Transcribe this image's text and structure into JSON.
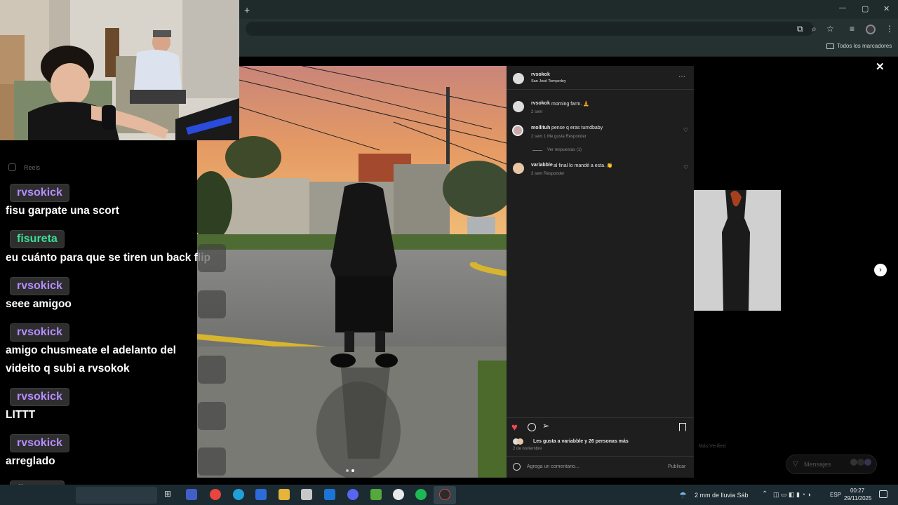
{
  "browser": {
    "new_tab": "+",
    "minimize": "—",
    "maximize": "▢",
    "close": "✕",
    "bookmarks_label": "Todos los marcadores"
  },
  "post": {
    "author": "rvsokok",
    "location": "San José Temperley",
    "caption_user": "rvsokok",
    "caption_text": "morning farm. 🧘",
    "caption_time": "2 sem",
    "comments": [
      {
        "user": "mollituh",
        "text": "pense q eras tumdbaby",
        "meta": "2 sem   1 Me gusta   Responder",
        "replies": "Ver respuestas (1)"
      },
      {
        "user": "variabble",
        "text": "al final lo mandé a esta. 👏",
        "meta": "3 sem   Responder"
      }
    ],
    "likes_text": "Les gusta a variabble y 26 personas más",
    "date": "2 de noviembre",
    "comment_placeholder": "Agrega un comentario...",
    "publish": "Publicar",
    "close": "✕"
  },
  "side": {
    "message_label": "Mensajes",
    "faded_text": "Más Verified"
  },
  "chat": {
    "header": "Reels",
    "messages": [
      {
        "user": "rvsokick",
        "color": "#b48cff",
        "text": "fisu garpate una scort"
      },
      {
        "user": "fisureta",
        "color": "#3ddc97",
        "text": "eu cuánto para que se tiren un back flip"
      },
      {
        "user": "rvsokick",
        "color": "#b48cff",
        "text": "seee amigoo"
      },
      {
        "user": "rvsokick",
        "color": "#b48cff",
        "text": "amigo chusmeate el adelanto del"
      },
      {
        "user": "",
        "color": "",
        "text": "videito q subi a rvsokok"
      },
      {
        "user": "rvsokick",
        "color": "#b48cff",
        "text": "LITTT"
      },
      {
        "user": "rvsokick",
        "color": "#b48cff",
        "text": "arreglado"
      },
      {
        "user": "fisureta",
        "color": "#3ddc97",
        "text": ""
      }
    ]
  },
  "taskbar": {
    "weather": "2 mm de lluvia Sáb",
    "lang": "ESP",
    "time": "00:27",
    "date": "29/11/2025"
  }
}
